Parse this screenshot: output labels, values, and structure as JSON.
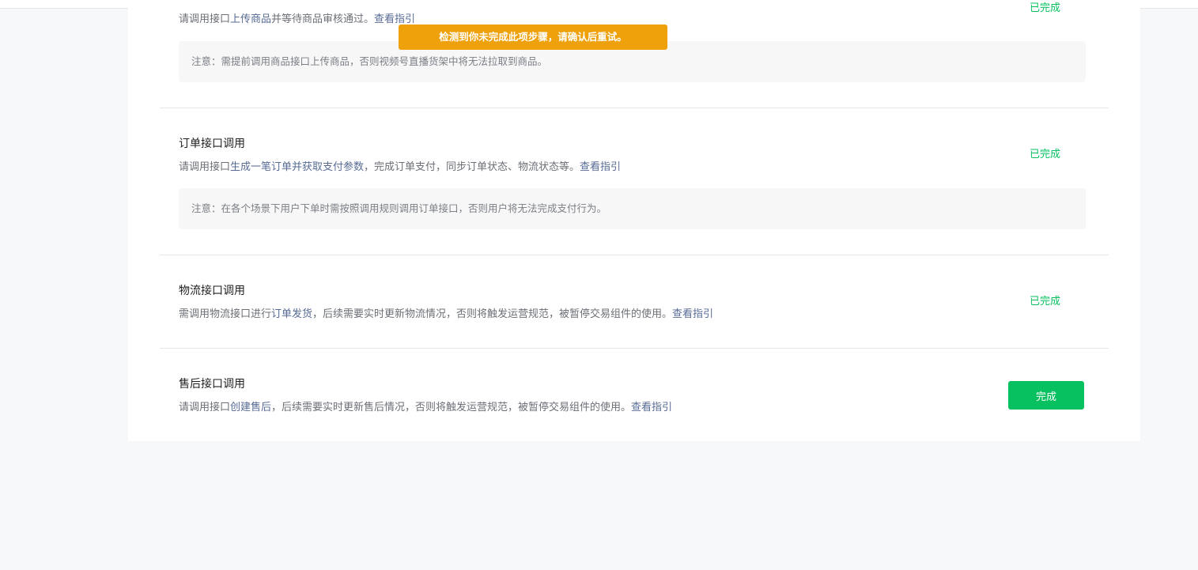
{
  "toast": {
    "message": "检测到你未完成此项步骤，请确认后重试。"
  },
  "sections": [
    {
      "title": "",
      "desc_prefix": "请调用接口",
      "desc_link": "上传商品",
      "desc_suffix": "并等待商品审核通过。",
      "guide_link": "查看指引",
      "note": "注意：需提前调用商品接口上传商品，否则视频号直播货架中将无法拉取到商品。",
      "status": "已完成"
    },
    {
      "title": "订单接口调用",
      "desc_prefix": "请调用接口",
      "desc_link": "生成一笔订单并获取支付参数",
      "desc_suffix": "，完成订单支付，同步订单状态、物流状态等。",
      "guide_link": "查看指引",
      "note": "注意：在各个场景下用户下单时需按照调用规则调用订单接口，否则用户将无法完成支付行为。",
      "status": "已完成"
    },
    {
      "title": "物流接口调用",
      "desc_prefix": "需调用物流接口进行",
      "desc_link": "订单发货",
      "desc_suffix": "，后续需要实时更新物流情况，否则将触发运营规范，被暂停交易组件的使用。",
      "guide_link": "查看指引",
      "status": "已完成"
    },
    {
      "title": "售后接口调用",
      "desc_prefix": "请调用接口",
      "desc_link": "创建售后",
      "desc_suffix": "，后续需要实时更新售后情况，否则将触发运营规范，被暂停交易组件的使用。",
      "guide_link": "查看指引",
      "button_label": "完成"
    }
  ],
  "colors": {
    "accent": "#07c160",
    "link": "#576b95",
    "toast": "#eea10b"
  }
}
